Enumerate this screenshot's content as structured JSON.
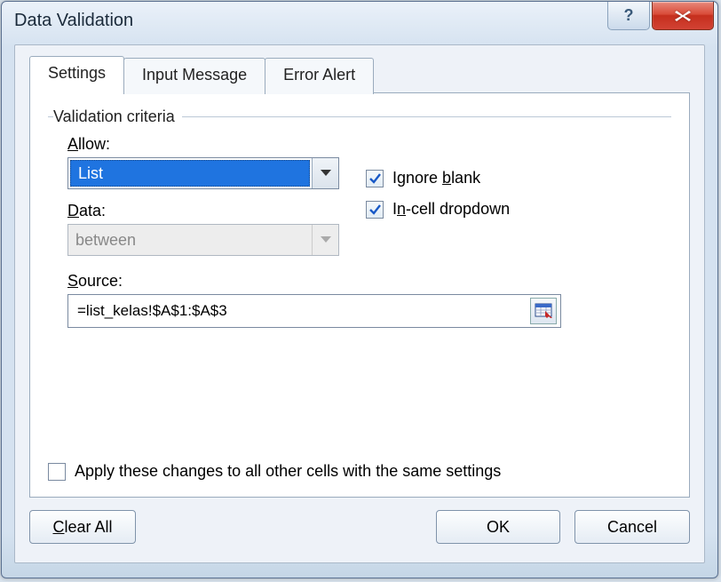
{
  "window": {
    "title": "Data Validation"
  },
  "tabs": [
    {
      "label": "Settings",
      "active": true
    },
    {
      "label": "Input Message",
      "active": false
    },
    {
      "label": "Error Alert",
      "active": false
    }
  ],
  "criteria": {
    "legend": "Validation criteria",
    "allow_label_pre": "A",
    "allow_label_post": "llow:",
    "allow_value": "List",
    "data_label_pre": "D",
    "data_label_post": "ata:",
    "data_value": "between",
    "source_label_pre": "S",
    "source_label_post": "ource:",
    "source_value": "=list_kelas!$A$1:$A$3"
  },
  "checks": {
    "ignore_blank": {
      "pre": "Ignore ",
      "ul": "b",
      "post": "lank",
      "checked": true
    },
    "incell_dropdown": {
      "pre": "I",
      "ul": "n",
      "post": "-cell dropdown",
      "checked": true
    }
  },
  "apply_all": {
    "pre": "Apply these changes to all other cells with the same settings",
    "checked": false
  },
  "buttons": {
    "clear_all_pre": "C",
    "clear_all_post": "lear All",
    "ok": "OK",
    "cancel": "Cancel"
  }
}
